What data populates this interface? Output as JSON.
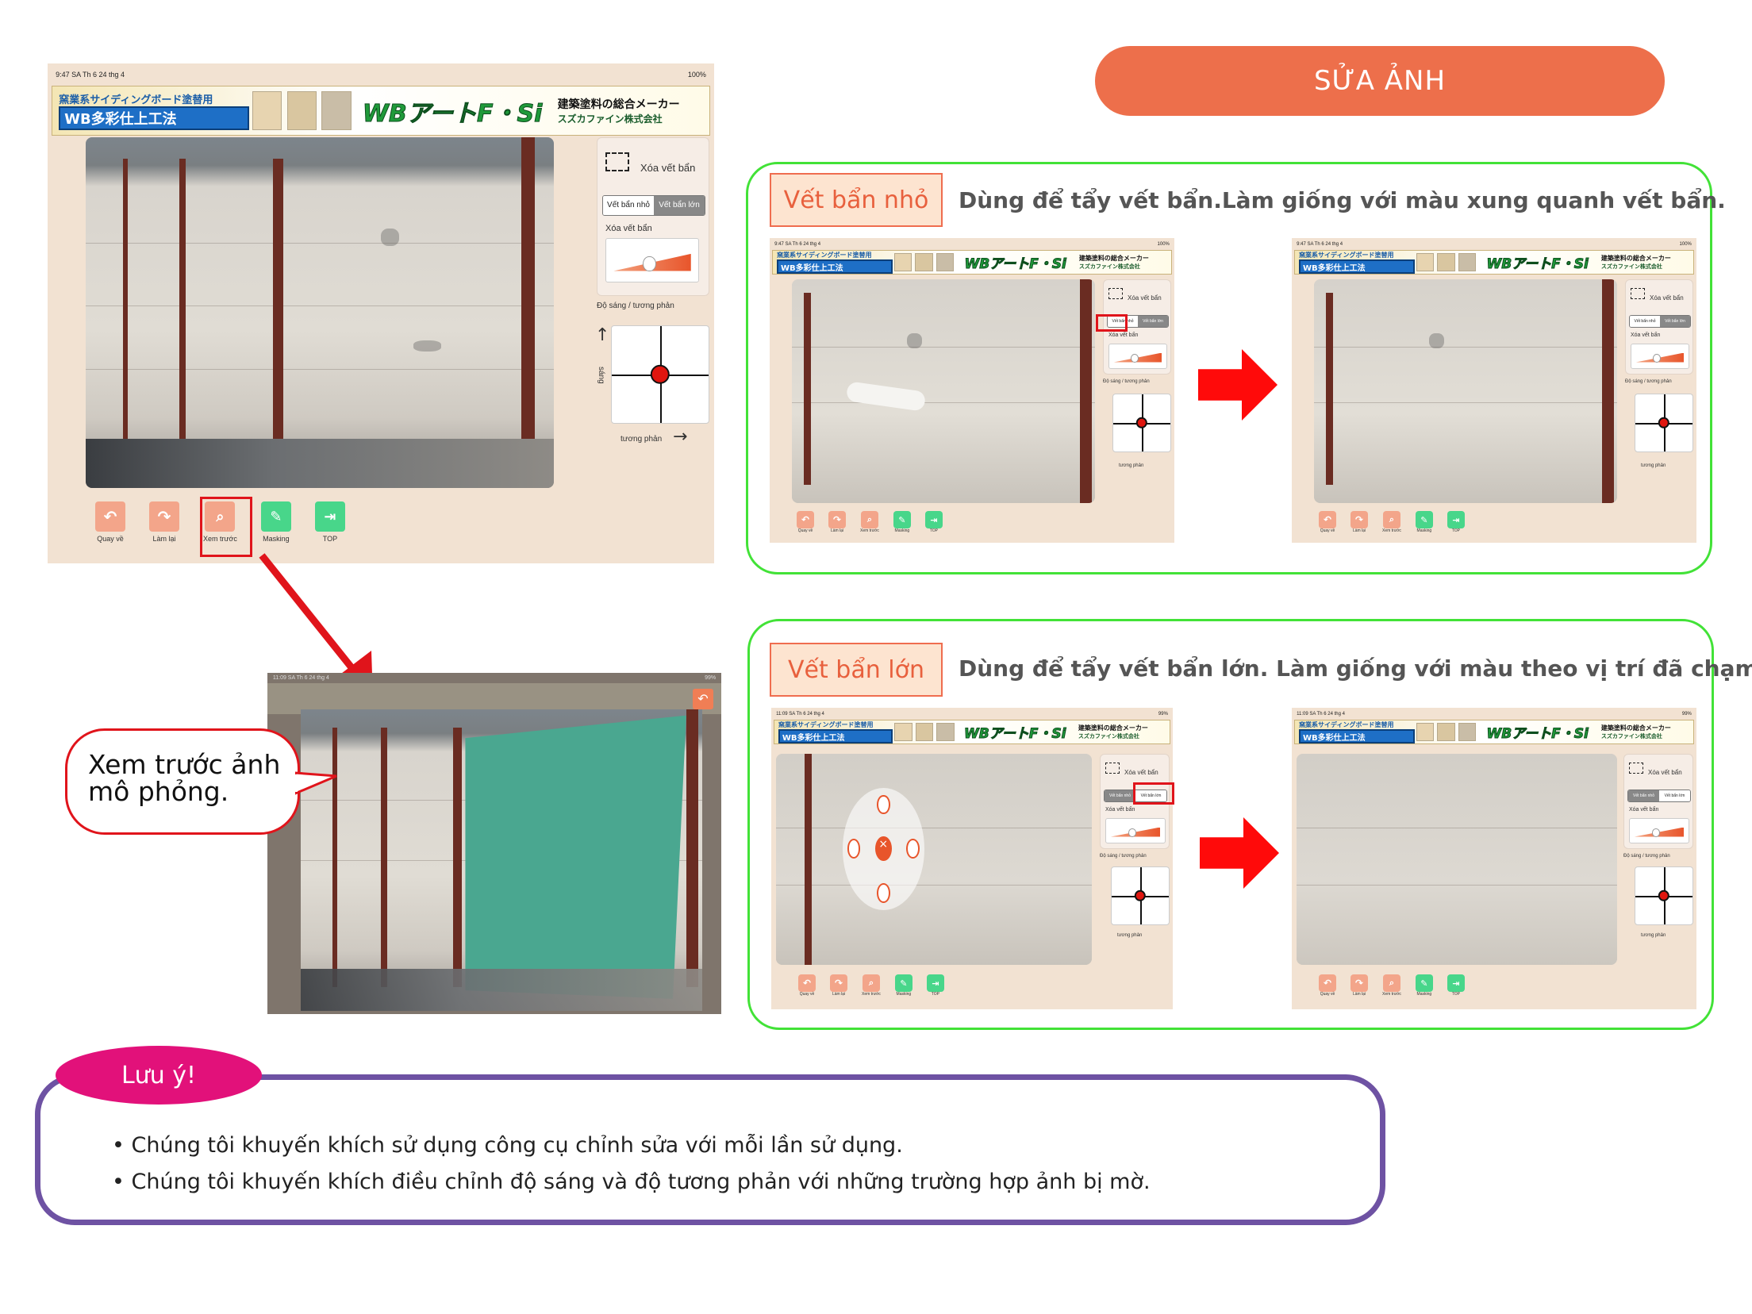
{
  "header": {
    "title": "SỬA ẢNH",
    "title_color": "#ed6f4b"
  },
  "ipad_ui": {
    "status_time_main": "9:47 SA  Th 6 24 thg 4",
    "status_time_preview": "11:09 SA  Th 6 24 thg 4",
    "status_right_main": "100%",
    "status_right_preview": "99%",
    "banner": {
      "jp_line1": "窯業系サイディングボード塗替用",
      "jp_line2": "WB多彩仕上工法",
      "logo": "WBアートF・Si",
      "company_line1": "建築塗料の総合メーカー",
      "company_line2": "スズカファイン株式会社"
    },
    "panel": {
      "erase_title": "Xóa vết bẩn",
      "seg_small": "Vết bẩn nhỏ",
      "seg_large": "Vết bẩn lớn",
      "slider_label": "Xóa vết bẩn",
      "brightness_label": "Độ sáng / tương phản",
      "axis_vertical": "sáng",
      "axis_horizontal": "tương phản"
    },
    "toolbar": {
      "undo": "Quay về",
      "redo": "Làm lại",
      "preview": "Xem trước",
      "masking": "Masking",
      "top": "TOP"
    }
  },
  "preview_callout": {
    "line1": "Xem trước ảnh",
    "line2": "mô phỏng."
  },
  "small_stain": {
    "tag": "Vết bẩn nhỏ",
    "description": "Dùng để tẩy vết bẩn.Làm giống với màu xung quanh vết bẩn."
  },
  "large_stain": {
    "tag": "Vết bẩn lớn",
    "description": "Dùng để tẩy vết bẩn lớn. Làm giống với màu theo vị trí đã chạm."
  },
  "note": {
    "badge": "Lưu ý!",
    "badge_color": "#e2117a",
    "border_color": "#6e52a3",
    "items": [
      "Chúng tôi khuyến khích sử dụng công cụ chỉnh sửa với mỗi lần sử dụng.",
      "Chúng tôi khuyến khích điều chỉnh độ sáng và độ tương phản với những trường hợp ảnh bị mờ."
    ]
  },
  "colors": {
    "arrow_red": "#ff0a0a",
    "frame_green": "#42e237",
    "tag_orange": "#ef6d4f",
    "mask_teal": "#4aa790"
  }
}
